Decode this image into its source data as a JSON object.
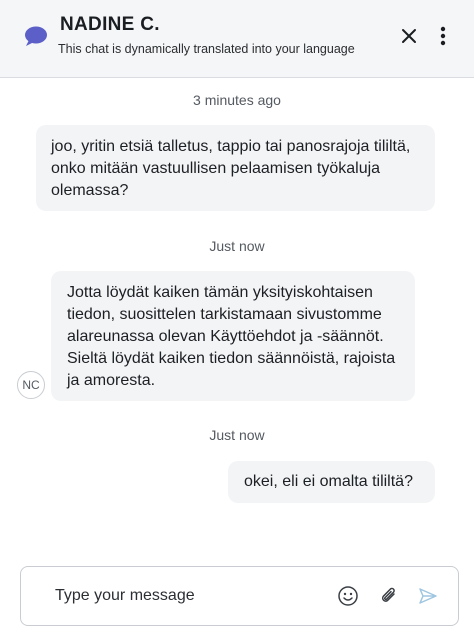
{
  "header": {
    "agent_name": "NADINE C.",
    "subtitle": "This chat is dynamically translated into your language",
    "logo_icon": "chat-bubble-icon",
    "close_icon": "close-icon",
    "more_icon": "more-vertical-icon",
    "brand_color": "#5b5fc7"
  },
  "messages": [
    {
      "timestamp": "3 minutes ago",
      "sender": "user",
      "text": "joo, yritin etsiä talletus, tappio tai panosrajoja tililtä, onko mitään vastuullisen pelaamisen työkaluja olemassa?"
    },
    {
      "timestamp": "Just now",
      "sender": "agent",
      "avatar_initials": "NC",
      "text": "Jotta löydät kaiken tämän yksityiskohtaisen tiedon, suosittelen tarkistamaan sivustomme alareunassa olevan Käyttöehdot ja -säännöt. Sieltä löydät kaiken tiedon säännöistä, rajoista ja amoresta."
    },
    {
      "timestamp": "Just now",
      "sender": "user",
      "text": "okei, eli ei omalta tililtä?"
    }
  ],
  "composer": {
    "placeholder": "Type your message",
    "value": "",
    "emoji_icon": "smiley-icon",
    "attach_icon": "paperclip-icon",
    "send_icon": "send-icon"
  }
}
